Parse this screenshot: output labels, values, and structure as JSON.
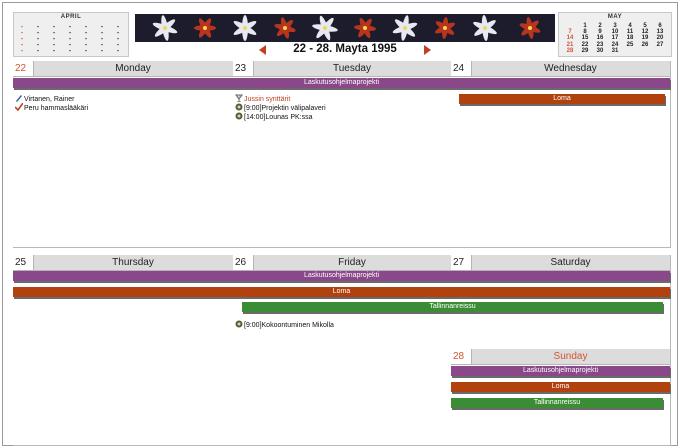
{
  "header": {
    "week_title": "22 - 28. Mayta 1995",
    "prev_label": "previous-week",
    "next_label": "next-week"
  },
  "mini_calendars": {
    "april": {
      "title": "APRIL"
    },
    "may": {
      "title": "MAY",
      "rows": [
        [
          "",
          "1",
          "2",
          "3",
          "4",
          "5",
          "6"
        ],
        [
          "7",
          "8",
          "9",
          "10",
          "11",
          "12",
          "13"
        ],
        [
          "14",
          "15",
          "16",
          "17",
          "18",
          "19",
          "20"
        ],
        [
          "21",
          "22",
          "23",
          "24",
          "25",
          "26",
          "27"
        ],
        [
          "28",
          "29",
          "30",
          "31",
          "",
          "",
          ""
        ]
      ]
    }
  },
  "days": {
    "mon": {
      "num": "22",
      "name": "Monday"
    },
    "tue": {
      "num": "23",
      "name": "Tuesday"
    },
    "wed": {
      "num": "24",
      "name": "Wednesday"
    },
    "thu": {
      "num": "25",
      "name": "Thursday"
    },
    "fri": {
      "num": "26",
      "name": "Friday"
    },
    "sat": {
      "num": "27",
      "name": "Saturday"
    },
    "sun": {
      "num": "28",
      "name": "Sunday"
    }
  },
  "bars": {
    "project": "Laskutusohjelmaprojekti",
    "vacation": "Loma",
    "trip": "Tallinnanreissu"
  },
  "events": {
    "mon_1": "Virtanen, Rainer",
    "mon_2": "Peru hammaslääkäri",
    "tue_1": "Jussin synttärit",
    "tue_2": "[9:00]Projektin välipalaveri",
    "tue_3": "[14:00]Lounas PK:ssa",
    "fri_1": "[9:00]Kokoontuminen Mikolla"
  },
  "colors": {
    "project": "#8a478a",
    "vacation": "#b1420e",
    "trip": "#3a8d34",
    "sunday": "#d0562f",
    "accent": "#c0401f"
  }
}
